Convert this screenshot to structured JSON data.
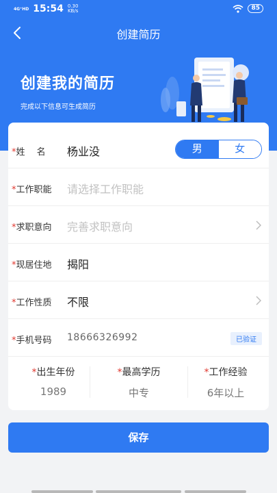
{
  "status_bar": {
    "network": "4G⁺HD",
    "time": "15:54",
    "speed_value": "0.30",
    "speed_unit": "KB/s",
    "battery": "85"
  },
  "nav": {
    "title": "创建简历"
  },
  "hero": {
    "title": "创建我的简历",
    "subtitle": "完成以下信息可生成简历"
  },
  "form": {
    "name": {
      "label": "姓　 名",
      "value": "杨业没"
    },
    "gender": {
      "male": "男",
      "female": "女",
      "selected": "男"
    },
    "job_function": {
      "label": "工作职能",
      "placeholder": "请选择工作职能"
    },
    "job_intent": {
      "label": "求职意向",
      "placeholder": "完善求职意向"
    },
    "residence": {
      "label": "现居住地",
      "value": "揭阳"
    },
    "job_type": {
      "label": "工作性质",
      "value": "不限"
    },
    "phone": {
      "label": "手机号码",
      "value": "18666326992",
      "badge": "已验证"
    },
    "birth_year": {
      "label": "出生年份",
      "value": "1989"
    },
    "education": {
      "label": "最高学历",
      "value": "中专"
    },
    "experience": {
      "label": "工作经验",
      "value": "6年以上"
    }
  },
  "save_label": "保存",
  "colors": {
    "accent": "#2f7af2",
    "required": "#e0382f",
    "background": "#f2f3f5"
  }
}
